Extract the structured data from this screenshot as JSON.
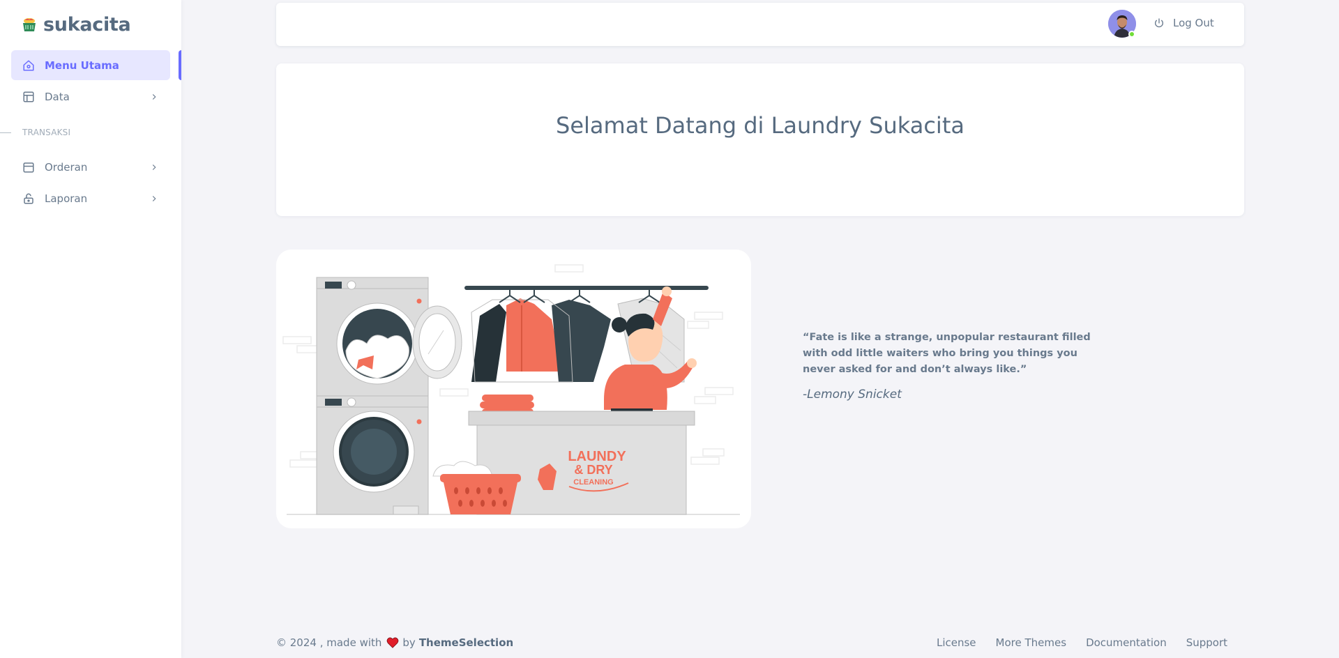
{
  "brand": {
    "name": "sukacita",
    "icon": "laundry-basket-icon"
  },
  "sidebar": {
    "items": [
      {
        "label": "Menu Utama",
        "icon": "home-icon",
        "active": true
      },
      {
        "label": "Data",
        "icon": "layout-icon",
        "has_submenu": true
      }
    ],
    "section_header": "TRANSAKSI",
    "transaksi_items": [
      {
        "label": "Orderan",
        "icon": "calendar-icon",
        "has_submenu": true
      },
      {
        "label": "Laporan",
        "icon": "lock-icon",
        "has_submenu": true
      }
    ]
  },
  "navbar": {
    "avatar": "user-avatar",
    "logout_label": "Log Out",
    "logout_icon": "power-icon"
  },
  "welcome": {
    "title": "Selamat Datang di Laundry Sukacita"
  },
  "illustration": {
    "sign_line1": "LAUNDY",
    "sign_line2": "& DRY",
    "sign_line3": "CLEANING"
  },
  "quote": {
    "text": "“Fate is like a strange, unpopular restaurant filled with odd little waiters who bring you things you never asked for and don’t always like.”",
    "author": "-Lemony Snicket"
  },
  "footer": {
    "copyright": "© 2024 , made with",
    "by": "by",
    "company": "ThemeSelection",
    "links": [
      "License",
      "More Themes",
      "Documentation",
      "Support"
    ]
  },
  "colors": {
    "primary": "#696cff",
    "primary_light": "#e7e7ff",
    "text": "#566a7f",
    "muted": "#a1acb8",
    "accent_coral": "#f2705a",
    "dark_teal": "#37474f",
    "online": "#71dd37",
    "heart": "#e01e2a"
  }
}
